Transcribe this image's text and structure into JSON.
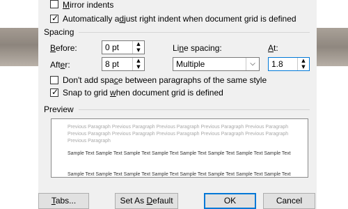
{
  "indentation": {
    "mirror_indents": {
      "label_pre": "",
      "label_u": "M",
      "label_post": "irror indents",
      "checked": false
    },
    "auto_adjust": {
      "label_pre": "Automatically a",
      "label_u": "d",
      "label_post": "just right indent when document grid is defined",
      "checked": true
    }
  },
  "spacing": {
    "section_title": "Spacing",
    "before": {
      "label_pre": "",
      "label_u": "B",
      "label_post": "efore:",
      "value": "0 pt"
    },
    "after": {
      "label_pre": "Aft",
      "label_u": "e",
      "label_post": "r:",
      "value": "8 pt"
    },
    "line_spacing": {
      "label_pre": "Li",
      "label_u": "n",
      "label_post": "e spacing:",
      "value": "Multiple"
    },
    "at": {
      "label_pre": "",
      "label_u": "A",
      "label_post": "t:",
      "value": "1.8"
    },
    "dont_add_space": {
      "label_pre": "Don't add spa",
      "label_u": "c",
      "label_post": "e between paragraphs of the same style",
      "checked": false
    },
    "snap_to_grid": {
      "label_pre": "Snap to grid ",
      "label_u": "w",
      "label_post": "hen document grid is defined",
      "checked": true
    }
  },
  "preview": {
    "section_title": "Preview",
    "previous_lines": [
      "Previous Paragraph Previous Paragraph Previous Paragraph Previous Paragraph Previous Paragraph",
      "Previous Paragraph Previous Paragraph Previous Paragraph Previous Paragraph Previous Paragraph",
      "Previous Paragraph"
    ],
    "sample_lines": [
      "Sample Text Sample Text Sample Text Sample Text Sample Text Sample Text Sample Text Sample Text",
      "Sample Text Sample Text Sample Text Sample Text Sample Text Sample Text Sample Text Sample Text"
    ]
  },
  "buttons": {
    "tabs": {
      "pre": "",
      "u": "T",
      "post": "abs..."
    },
    "set_default": {
      "pre": "Set As ",
      "u": "D",
      "post": "efault"
    },
    "ok": "OK",
    "cancel": "Cancel"
  },
  "icons": {
    "check": "check-icon",
    "spin_up": "spin-up-icon",
    "spin_down": "spin-down-icon",
    "dropdown": "chevron-down-icon"
  },
  "colors": {
    "dialog_bg": "#f0f0f0",
    "default_button_border": "#0078d7"
  }
}
